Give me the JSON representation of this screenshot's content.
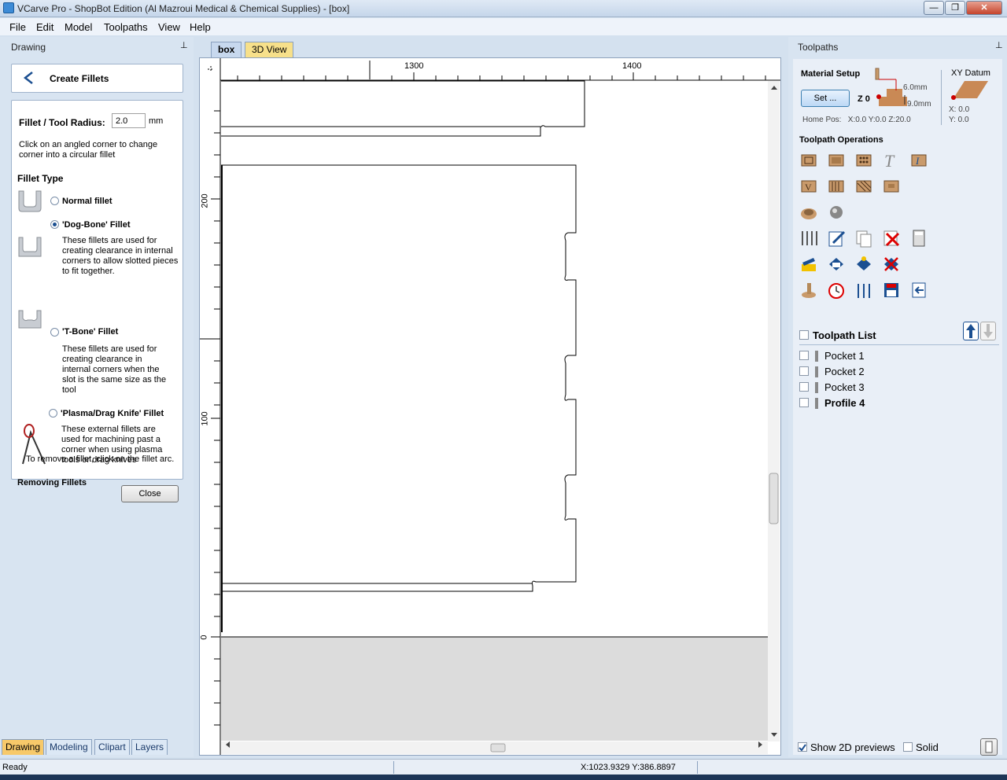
{
  "window": {
    "title": "VCarve Pro - ShopBot Edition (Al Mazroui Medical & Chemical Supplies) - [box]",
    "minimize": "—",
    "maximize": "❐",
    "close": "✕"
  },
  "menu": [
    "File",
    "Edit",
    "Model",
    "Toolpaths",
    "View",
    "Help"
  ],
  "mdi_controls": {
    "min": "_",
    "restore": "❐",
    "close": "✕"
  },
  "left_panel": {
    "title": "Drawing",
    "pin": "⊥",
    "header_title": "Create Fillets",
    "radius_label": "Fillet / Tool Radius:",
    "radius_value": "2.0",
    "radius_unit": "mm",
    "instruction": "Click on an angled corner to change corner into a circular fillet",
    "fillet_type_label": "Fillet Type",
    "options": [
      {
        "label": "Normal fillet",
        "desc": "",
        "selected": false
      },
      {
        "label": "'Dog-Bone' Fillet",
        "desc": "These fillets are used for creating clearance in internal corners to allow slotted pieces to fit together.",
        "selected": true
      },
      {
        "label": "'T-Bone' Fillet",
        "desc": "These fillets are used for creating clearance in internal corners when the slot is the same size as the tool",
        "selected": false
      },
      {
        "label": "'Plasma/Drag Knife' Fillet",
        "desc": "These external fillets are used for machining past a corner when using plasma tools or drag knives",
        "selected": false
      }
    ],
    "removing_label": "Removing Fillets",
    "removing_text": "To remove a fillet, click on the fillet arc.",
    "close_label": "Close",
    "tabs": [
      "Drawing",
      "Modeling",
      "Clipart",
      "Layers"
    ]
  },
  "document_tabs": [
    "box",
    "3D View"
  ],
  "ruler": {
    "top_labels": [
      "1300",
      "1400"
    ],
    "left_labels": [
      "200",
      "100",
      "0"
    ]
  },
  "right_panel": {
    "title": "Toolpaths",
    "pin": "⊥",
    "material_setup_label": "Material Setup",
    "set_button": "Set ...",
    "z_label": "Z 0",
    "thickness_top": "6.0mm",
    "thickness_bottom": "9.0mm",
    "home_pos": "Home Pos:   X:0.0 Y:0.0 Z:20.0",
    "xy_datum_label": "XY Datum",
    "datum_x": "X: 0.0",
    "datum_y": "Y: 0.0",
    "operations_label": "Toolpath Operations",
    "toolpath_list_label": "Toolpath List",
    "toolpaths": [
      {
        "name": "Pocket 1",
        "bold": false
      },
      {
        "name": "Pocket 2",
        "bold": false
      },
      {
        "name": "Pocket 3",
        "bold": false
      },
      {
        "name": "Profile 4",
        "bold": true
      }
    ],
    "show_previews_label": "Show 2D previews",
    "show_previews_checked": true,
    "solid_label": "Solid",
    "solid_checked": false
  },
  "status": {
    "text": "Ready",
    "coords": "X:1023.9329 Y:386.8897"
  },
  "colors": {
    "accent_tab": "#f7c96a",
    "toolpath_icon": "#c99a6b",
    "canvas_bg": "#ffffff",
    "table_gray": "#dcdcdc"
  }
}
